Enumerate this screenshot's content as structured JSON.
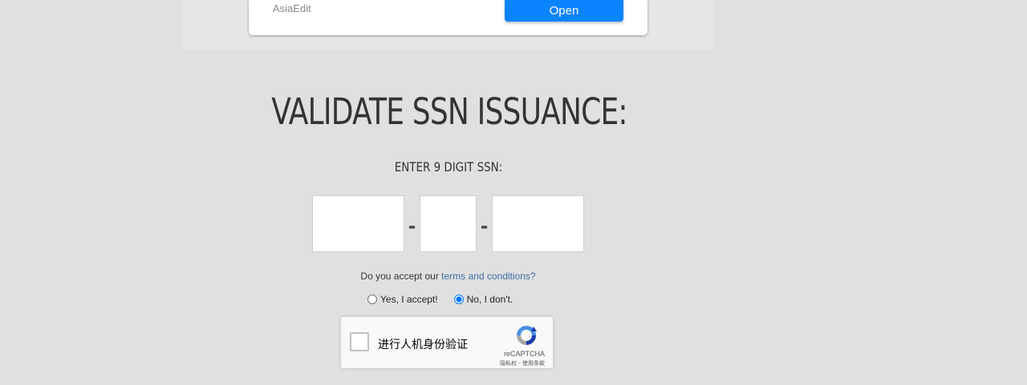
{
  "ad": {
    "brand": "AsiaEdit",
    "open_label": "Open"
  },
  "title": "VALIDATE SSN ISSUANCE:",
  "subtitle": "ENTER 9 DIGIT SSN:",
  "ssn": {
    "part1": "",
    "part2": "",
    "part3": "",
    "separator": "-"
  },
  "terms": {
    "prefix": "Do you accept our ",
    "link_label": "terms and conditions?"
  },
  "radios": {
    "yes_label": "Yes, I accept!",
    "no_label": "No, I don't.",
    "selected": "no"
  },
  "recaptcha": {
    "label": "进行人机身份验证",
    "brand": "reCAPTCHA",
    "privacy": "隐私权",
    "link_separator": " - ",
    "terms": "使用条款",
    "logo_icon": "recaptcha-logo-icon"
  },
  "colors": {
    "page_bg": "#e0e0e0",
    "accent": "#0a84ff",
    "link": "#3b6ea5"
  }
}
